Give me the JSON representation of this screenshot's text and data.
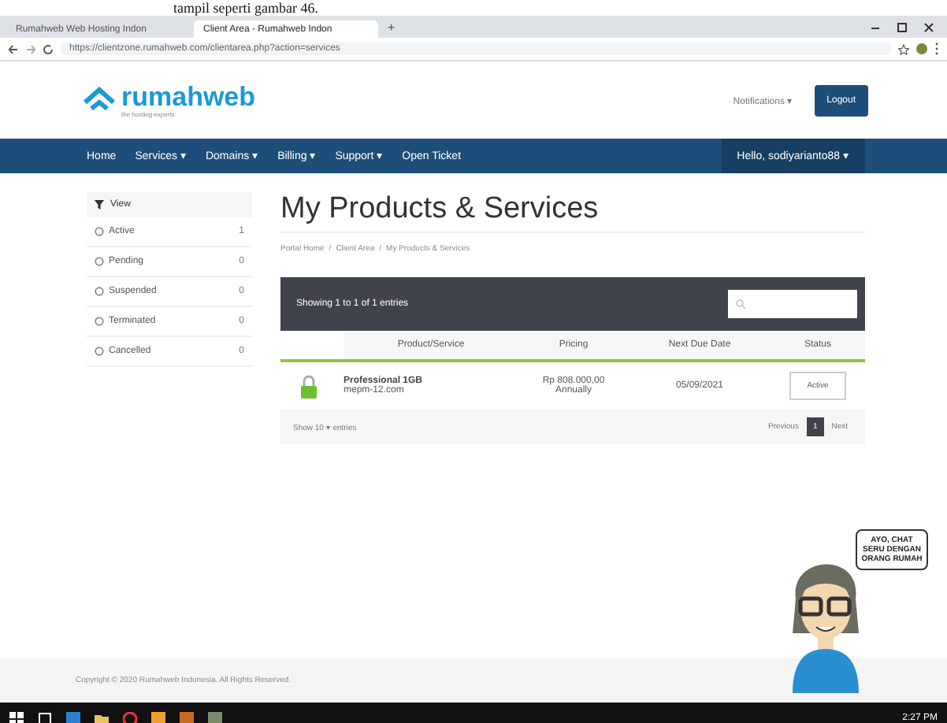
{
  "document_text": "tampil seperti gambar 46.",
  "browser": {
    "tabs": [
      {
        "title": "Rumahweb Web Hosting Indon",
        "selected": false
      },
      {
        "title": "Client Area - Rumahweb Indon",
        "selected": true
      }
    ],
    "new_tab": "+",
    "url": "https://clientzone.rumahweb.com/clientarea.php?action=services"
  },
  "header": {
    "logo": "rumahweb",
    "logo_tagline": "the hosting experts",
    "notifications": "Notifications ▾",
    "logout": "Logout"
  },
  "nav": {
    "items": [
      "Home",
      "Services ▾",
      "Domains ▾",
      "Billing ▾",
      "Support ▾",
      "Open Ticket"
    ],
    "user": "Hello, sodiyarianto88 ▾"
  },
  "sidebar": {
    "title": "View",
    "items": [
      {
        "label": "Active",
        "count": "1"
      },
      {
        "label": "Pending",
        "count": "0"
      },
      {
        "label": "Suspended",
        "count": "0"
      },
      {
        "label": "Terminated",
        "count": "0"
      },
      {
        "label": "Cancelled",
        "count": "0"
      }
    ]
  },
  "page": {
    "title": "My Products & Services",
    "breadcrumb": [
      "Portal Home",
      "/",
      "Client Area",
      "/",
      "My Products & Services"
    ]
  },
  "table": {
    "info": "Showing 1 to 1 of 1 entries",
    "columns": [
      "Product/Service",
      "Pricing",
      "Next Due Date",
      "Status"
    ],
    "rows": [
      {
        "product": "Professional 1GB",
        "domain": "mepm-12.com",
        "price": "Rp 808.000,00",
        "cycle": "Annually",
        "due": "05/09/2021",
        "status": "Active"
      }
    ],
    "length": "Show 10 ▾ entries",
    "pager": [
      {
        "label": "Previous",
        "selected": false
      },
      {
        "label": "1",
        "selected": true
      },
      {
        "label": "Next",
        "selected": false
      }
    ]
  },
  "footer": "Copyright © 2020 Rumahweb Indonesia. All Rights Reserved.",
  "chat": {
    "bubble": "AYO, CHAT SERU DENGAN ORANG RUMAH"
  },
  "taskbar": {
    "time": "2:27 PM"
  }
}
